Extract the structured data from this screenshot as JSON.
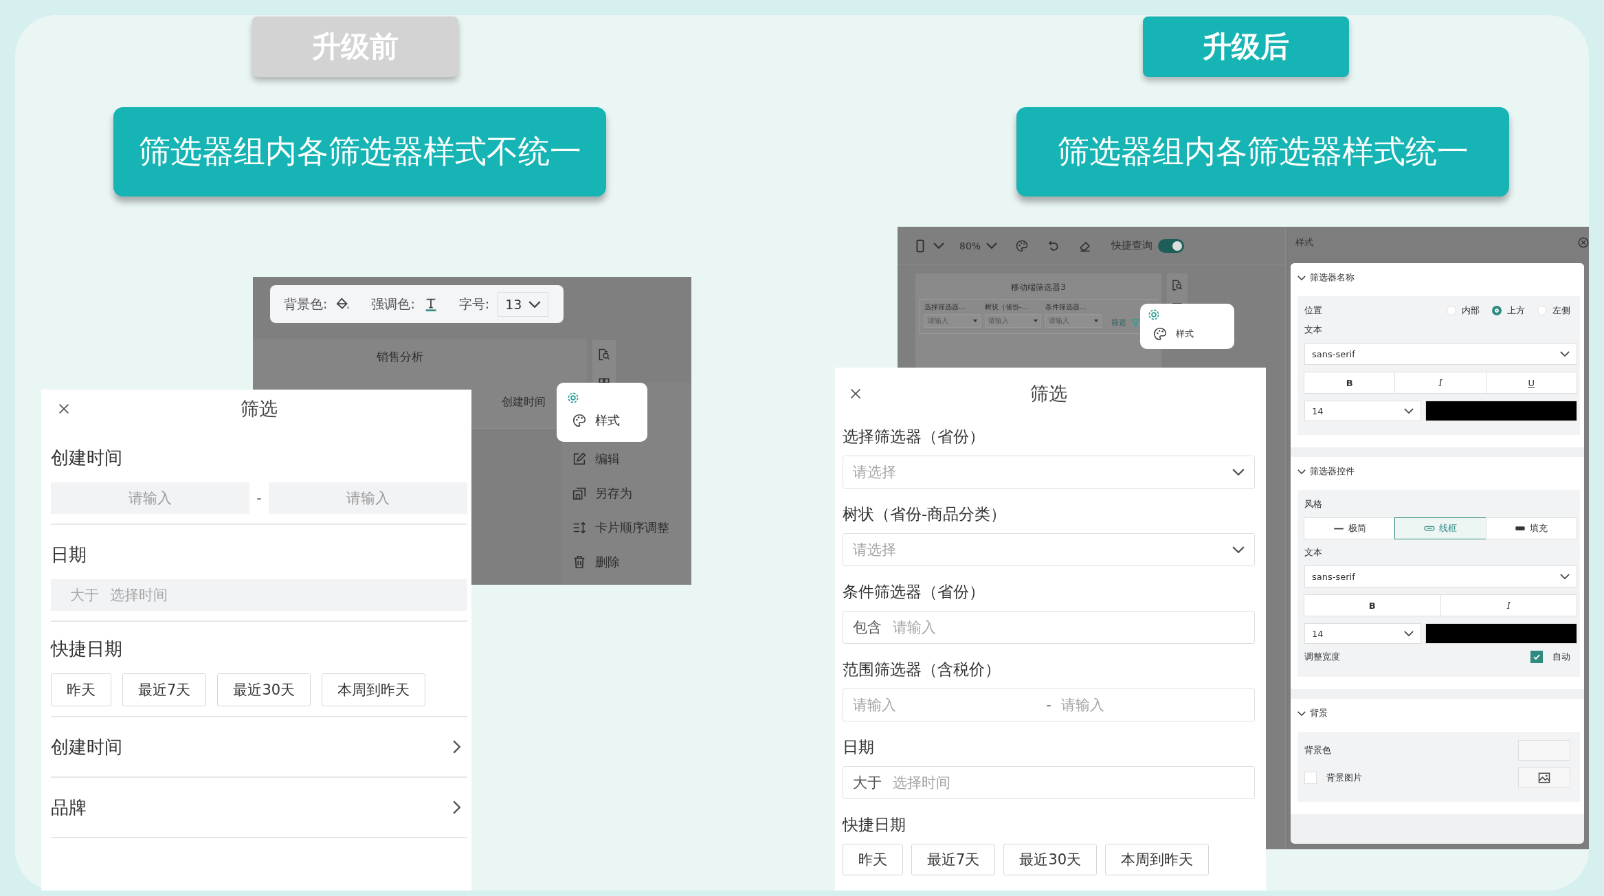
{
  "before": {
    "tag": "升级前",
    "banner": "筛选器组内各筛选器样式不统一",
    "editor": {
      "toolbar": {
        "background_label": "背景色:",
        "accent_label": "强调色:",
        "size_label": "字号:",
        "size_value": "13"
      },
      "card_title": "销售分析",
      "card_field": "创建时间",
      "menu": [
        {
          "kind": "style",
          "label": "样式",
          "highlighted": true
        },
        {
          "kind": "edit",
          "label": "编辑",
          "highlighted": false
        },
        {
          "kind": "save_as",
          "label": "另存为",
          "highlighted": false
        },
        {
          "kind": "reorder",
          "label": "卡片顺序调整",
          "highlighted": false
        },
        {
          "kind": "delete",
          "label": "删除",
          "highlighted": false
        }
      ]
    },
    "panel": {
      "title": "筛选",
      "sections": [
        {
          "kind": "range",
          "label": "创建时间",
          "placeholders": [
            "请输入",
            "请输入"
          ],
          "separator": "-"
        },
        {
          "kind": "condition",
          "label": "日期",
          "operator": "大于",
          "placeholder": "选择时间"
        },
        {
          "kind": "quick",
          "label": "快捷日期",
          "options": [
            "昨天",
            "最近7天",
            "最近30天",
            "本周到昨天"
          ]
        },
        {
          "kind": "link",
          "label": "创建时间"
        },
        {
          "kind": "link",
          "label": "品牌"
        }
      ]
    }
  },
  "after": {
    "tag": "升级后",
    "banner": "筛选器组内各筛选器样式统一",
    "editor": {
      "toolbar": {
        "zoom": "80%",
        "quick_query_label": "快捷查询",
        "quick_query_on": true
      },
      "card_title": "移动端筛选器3",
      "filters": [
        {
          "label": "选择筛选器...",
          "placeholder": "请输入"
        },
        {
          "label": "树状（省份-...",
          "placeholder": "请输入"
        },
        {
          "label": "条件筛选器...",
          "placeholder": "请输入"
        }
      ],
      "filter_link": "筛选",
      "menu": [
        {
          "kind": "style",
          "label": "样式",
          "highlighted": true
        }
      ]
    },
    "style_panel": {
      "title": "样式",
      "sections": [
        {
          "title": "筛选器名称",
          "expanded": true,
          "rows": [
            {
              "kind": "radios",
              "label": "位置",
              "options": [
                {
                  "label": "内部",
                  "selected": false
                },
                {
                  "label": "上方",
                  "selected": true
                },
                {
                  "label": "左侧",
                  "selected": false
                }
              ]
            },
            {
              "kind": "caption",
              "label": "文本"
            },
            {
              "kind": "select",
              "value": "sans-serif"
            },
            {
              "kind": "format",
              "buttons": [
                {
                  "label": "B"
                },
                {
                  "label": "I"
                },
                {
                  "label": "U"
                }
              ]
            },
            {
              "kind": "size_color",
              "size": "14",
              "color": "#000000"
            }
          ]
        },
        {
          "title": "筛选器控件",
          "expanded": true,
          "rows": [
            {
              "kind": "segments",
              "label": "风格",
              "options": [
                {
                  "label": "极简",
                  "selected": false
                },
                {
                  "label": "线框",
                  "selected": true
                },
                {
                  "label": "填充",
                  "selected": false
                }
              ]
            },
            {
              "kind": "caption",
              "label": "文本"
            },
            {
              "kind": "select",
              "value": "sans-serif"
            },
            {
              "kind": "format",
              "buttons": [
                {
                  "label": "B"
                },
                {
                  "label": "I"
                }
              ]
            },
            {
              "kind": "size_color",
              "size": "14",
              "color": "#000000"
            },
            {
              "kind": "checkbox",
              "label": "调整宽度",
              "option": "自动",
              "checked": true
            }
          ]
        },
        {
          "title": "背景",
          "expanded": true,
          "rows": [
            {
              "kind": "swatch",
              "label": "背景色"
            },
            {
              "kind": "image",
              "label": "背景图片",
              "checked": false
            }
          ]
        }
      ]
    },
    "panel": {
      "title": "筛选",
      "sections": [
        {
          "kind": "select",
          "label": "选择筛选器（省份）",
          "placeholder": "请选择"
        },
        {
          "kind": "select",
          "label": "树状（省份-商品分类）",
          "placeholder": "请选择"
        },
        {
          "kind": "condition",
          "label": "条件筛选器（省份）",
          "operator": "包含",
          "placeholder": "请输入"
        },
        {
          "kind": "range",
          "label": "范围筛选器（含税价）",
          "placeholders": [
            "请输入",
            "请输入"
          ],
          "separator": "-"
        },
        {
          "kind": "condition",
          "label": "日期",
          "operator": "大于",
          "placeholder": "选择时间"
        },
        {
          "kind": "quick",
          "label": "快捷日期",
          "options": [
            "昨天",
            "最近7天",
            "最近30天",
            "本周到昨天"
          ]
        }
      ]
    }
  }
}
